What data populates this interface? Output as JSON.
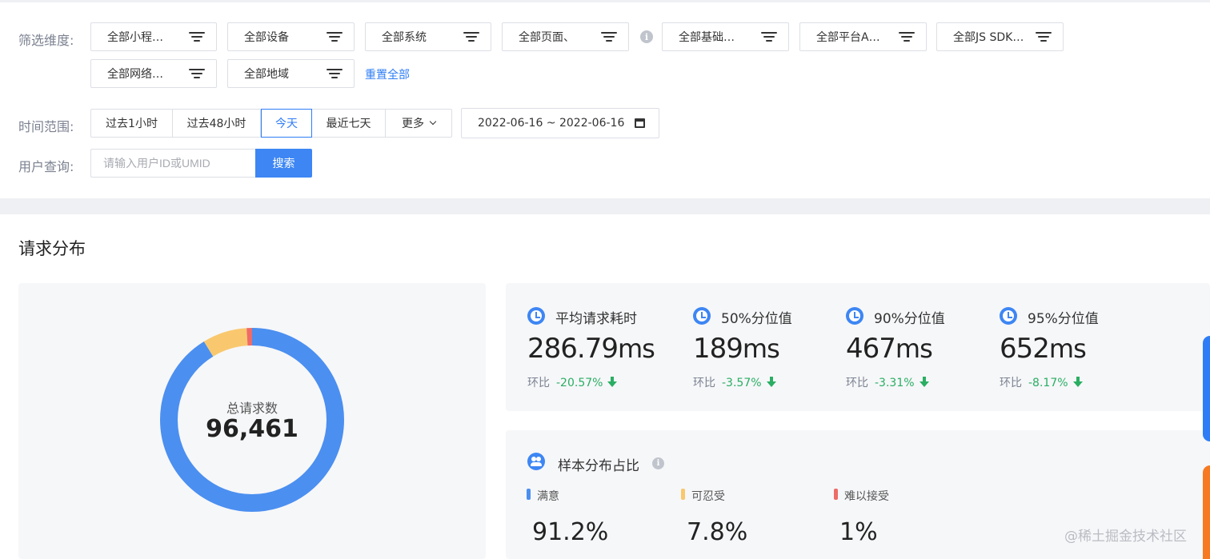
{
  "filters": {
    "label": "筛选维度:",
    "row1": [
      "全部小程…",
      "全部设备",
      "全部系统",
      "全部页面、",
      "全部基础…",
      "全部平台A…",
      "全部JS SDK…"
    ],
    "row2": [
      "全部网络…",
      "全部地域"
    ],
    "reset_label": "重置全部"
  },
  "time_range": {
    "label": "时间范围:",
    "options": [
      "过去1小时",
      "过去48小时",
      "今天",
      "最近七天",
      "更多"
    ],
    "selected": "今天",
    "date_range": "2022-06-16 ~ 2022-06-16"
  },
  "user_query": {
    "label": "用户查询:",
    "placeholder": "请输入用户ID或UMID",
    "search_label": "搜索"
  },
  "section": {
    "title": "请求分布"
  },
  "donut": {
    "label": "总请求数",
    "value": "96,461",
    "slices": [
      {
        "name": "满意",
        "percent": 91.2,
        "color": "#4b8ff0"
      },
      {
        "name": "可忍受",
        "percent": 7.8,
        "color": "#f9c86e"
      },
      {
        "name": "难以接受",
        "percent": 1.0,
        "color": "#ee6b67"
      }
    ]
  },
  "metrics": [
    {
      "label": "平均请求耗时",
      "value": "286.79",
      "unit": "ms",
      "compare_label": "环比",
      "compare_value": "-20.57%"
    },
    {
      "label": "50%分位值",
      "value": "189",
      "unit": "ms",
      "compare_label": "环比",
      "compare_value": "-3.57%"
    },
    {
      "label": "90%分位值",
      "value": "467",
      "unit": "ms",
      "compare_label": "环比",
      "compare_value": "-3.31%"
    },
    {
      "label": "95%分位值",
      "value": "652",
      "unit": "ms",
      "compare_label": "环比",
      "compare_value": "-8.17%"
    }
  ],
  "distribution": {
    "title": "样本分布占比",
    "items": [
      {
        "label": "满意",
        "value": "91.2%",
        "color": "#4b8ff0"
      },
      {
        "label": "可忍受",
        "value": "7.8%",
        "color": "#f9c86e"
      },
      {
        "label": "难以接受",
        "value": "1%",
        "color": "#ee6b67"
      }
    ]
  },
  "watermark": "@稀土掘金技术社区",
  "colors": {
    "accent": "#2f7df6",
    "positive_change": "#2aae63"
  }
}
